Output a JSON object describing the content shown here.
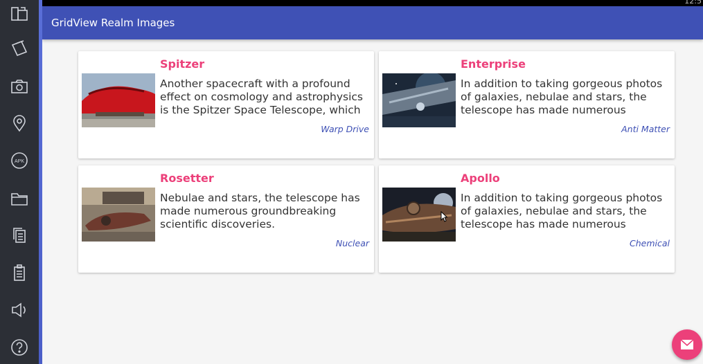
{
  "app": {
    "title": "GridView Realm Images"
  },
  "status": {
    "clock": "12:5"
  },
  "cards": [
    {
      "title": "Spitzer",
      "description": "Another spacecraft with a profound effect on cosmology and astrophysics is the Spitzer Space Telescope, which",
      "tag": "Warp Drive"
    },
    {
      "title": "Enterprise",
      "description": "In addition to taking gorgeous photos of galaxies, nebulae and stars, the telescope has made numerous groundbreaking",
      "tag": "Anti Matter"
    },
    {
      "title": "Rosetter",
      "description": "Nebulae and stars, the telescope has made numerous groundbreaking scientific discoveries.",
      "tag": "Nuclear"
    },
    {
      "title": "Apollo",
      "description": "In addition to taking gorgeous photos of galaxies, nebulae and stars, the telescope has made numerous groundbreaking",
      "tag": "Chemical"
    }
  ],
  "sidebar": {
    "icons": [
      "rotate-icon",
      "screenshot-icon",
      "camera-icon",
      "location-icon",
      "apk-icon",
      "folder-icon",
      "copy-icon",
      "paste-icon",
      "volume-icon",
      "help-icon"
    ],
    "apk_label": "APK"
  },
  "fab": {
    "icon": "mail-icon"
  },
  "colors": {
    "appbar": "#3f51b5",
    "accent": "#ec407a",
    "tag": "#3f51b5"
  }
}
